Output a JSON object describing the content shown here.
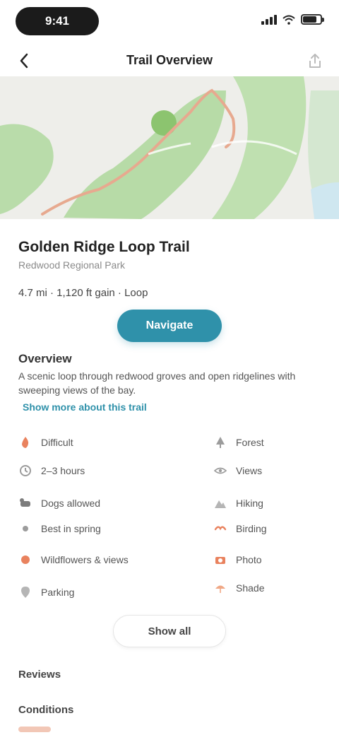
{
  "status_bar": {
    "time": "9:41"
  },
  "nav": {
    "title": "Trail Overview",
    "back_icon": "chevron-left-icon",
    "share_icon": "share-icon"
  },
  "map": {
    "route_color": "#e7a98f",
    "park_color": "#a9d79a",
    "water_color": "#cfe7f0"
  },
  "trail": {
    "name": "Golden Ridge Loop Trail",
    "location": "Redwood Regional Park",
    "stats": "4.7 mi · 1,120 ft gain · Loop"
  },
  "primary_action": {
    "label": "Navigate"
  },
  "about": {
    "title": "Overview",
    "description": "A scenic loop through redwood groves and open ridgelines with sweeping views of the bay.",
    "read_more": "Show more about this trail"
  },
  "features": [
    {
      "icon": "flame-icon",
      "label": "Difficult",
      "accent": "#e9825e"
    },
    {
      "icon": "clock-icon",
      "label": "2–3 hours",
      "accent": "#9c9c9c"
    },
    {
      "icon": "dog-icon",
      "label": "Dogs allowed",
      "accent": "#7c7c7c"
    },
    {
      "icon": "sun-icon",
      "label": "Best in spring",
      "accent": "#9c9c9c"
    },
    {
      "icon": "flower-icon",
      "label": "Wildflowers & views",
      "accent": "#e9825e"
    },
    {
      "icon": "pin-icon",
      "label": "Parking",
      "accent": "#9c9c9c"
    },
    {
      "icon": "tree-icon",
      "label": "Forest",
      "accent": "#9c9c9c"
    },
    {
      "icon": "eye-icon",
      "label": "Views",
      "accent": "#9c9c9c"
    },
    {
      "icon": "mountain-icon",
      "label": "Hiking",
      "accent": "#9c9c9c"
    },
    {
      "icon": "bird-icon",
      "label": "Birding",
      "accent": "#e9825e"
    },
    {
      "icon": "camera-icon",
      "label": "Photo",
      "accent": "#e9825e"
    },
    {
      "icon": "shade-icon",
      "label": "Shade",
      "accent": "#e9825e"
    }
  ],
  "see_all": {
    "label": "Show all"
  },
  "lists": [
    {
      "label": "Reviews"
    },
    {
      "label": "Conditions"
    }
  ]
}
